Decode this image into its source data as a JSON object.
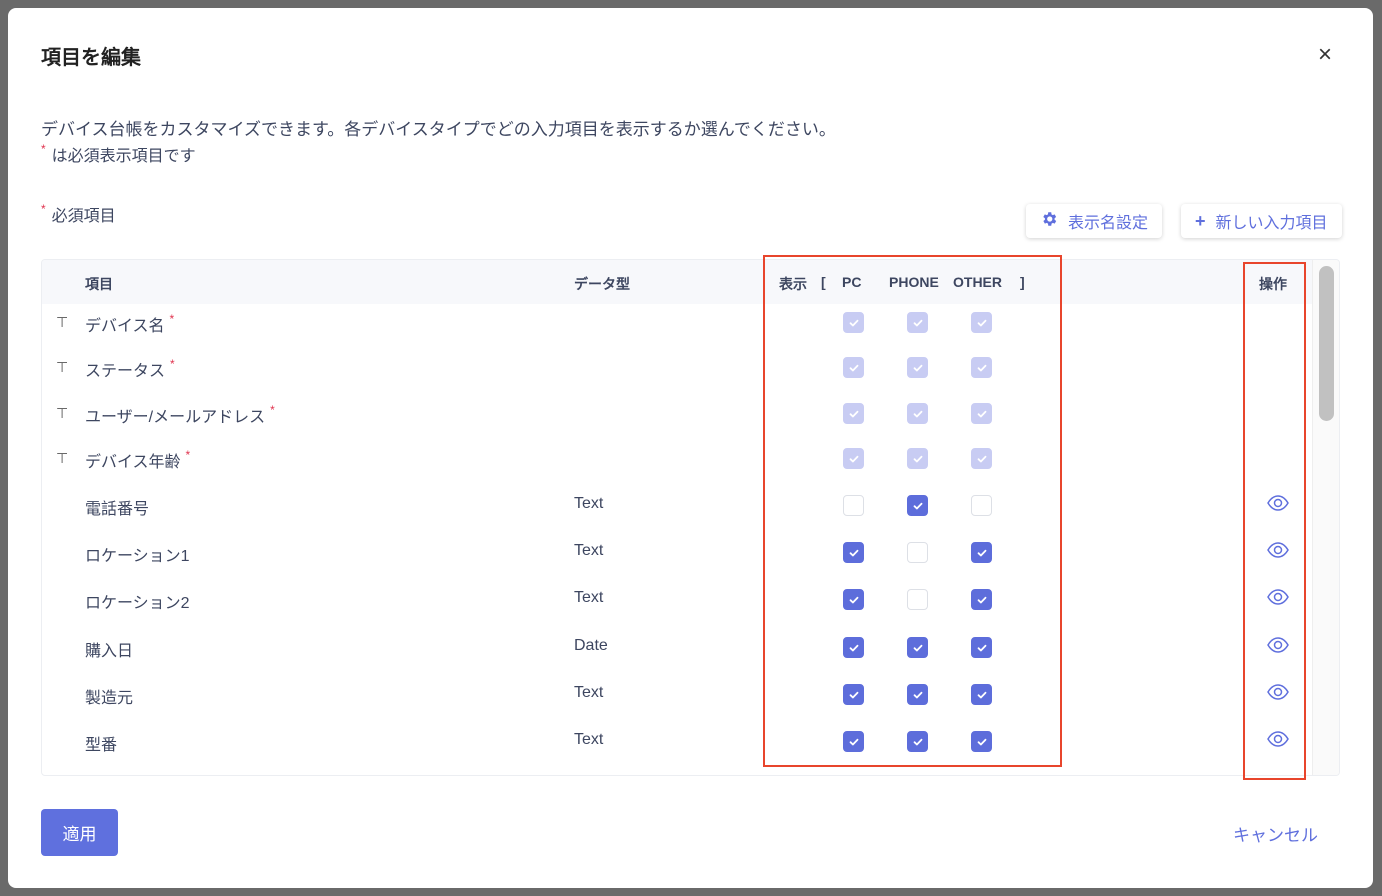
{
  "dialog": {
    "title": "項目を編集",
    "close_icon": "×",
    "description": "デバイス台帳をカスタマイズできます。各デバイスタイプでどの入力項目を表示するか選んでください。",
    "required_note": "は必須表示項目です",
    "required_section_label": "必須項目",
    "star": "*",
    "display_name_button": "表示名設定",
    "new_field_button": "新しい入力項目",
    "plus": "+",
    "apply_button": "適用",
    "cancel_button": "キャンセル"
  },
  "table": {
    "headers": {
      "item": "項目",
      "type": "データ型",
      "display": "表示",
      "bracket_open": "[",
      "pc": "PC",
      "phone": "PHONE",
      "other": "OTHER",
      "bracket_close": "]",
      "actions": "操作"
    },
    "rows": [
      {
        "name": "デバイス名",
        "required": true,
        "pinned": true,
        "type": "",
        "pc": true,
        "phone": true,
        "other": true
      },
      {
        "name": "ステータス",
        "required": true,
        "pinned": true,
        "type": "",
        "pc": true,
        "phone": true,
        "other": true
      },
      {
        "name": "ユーザー/メールアドレス",
        "required": true,
        "pinned": true,
        "type": "",
        "pc": true,
        "phone": true,
        "other": true
      },
      {
        "name": "デバイス年齢",
        "required": true,
        "pinned": true,
        "type": "",
        "pc": true,
        "phone": true,
        "other": true
      },
      {
        "name": "電話番号",
        "required": false,
        "pinned": false,
        "type": "Text",
        "pc": false,
        "phone": true,
        "other": false
      },
      {
        "name": "ロケーション1",
        "required": false,
        "pinned": false,
        "type": "Text",
        "pc": true,
        "phone": false,
        "other": true
      },
      {
        "name": "ロケーション2",
        "required": false,
        "pinned": false,
        "type": "Text",
        "pc": true,
        "phone": false,
        "other": true
      },
      {
        "name": "購入日",
        "required": false,
        "pinned": false,
        "type": "Date",
        "pc": true,
        "phone": true,
        "other": true
      },
      {
        "name": "製造元",
        "required": false,
        "pinned": false,
        "type": "Text",
        "pc": true,
        "phone": true,
        "other": true
      },
      {
        "name": "型番",
        "required": false,
        "pinned": false,
        "type": "Text",
        "pc": true,
        "phone": true,
        "other": true
      }
    ]
  },
  "colors": {
    "accent": "#5d6ddb",
    "disabled": "#c8ccf3",
    "highlight": "#e8452c",
    "required": "#e0334e"
  }
}
